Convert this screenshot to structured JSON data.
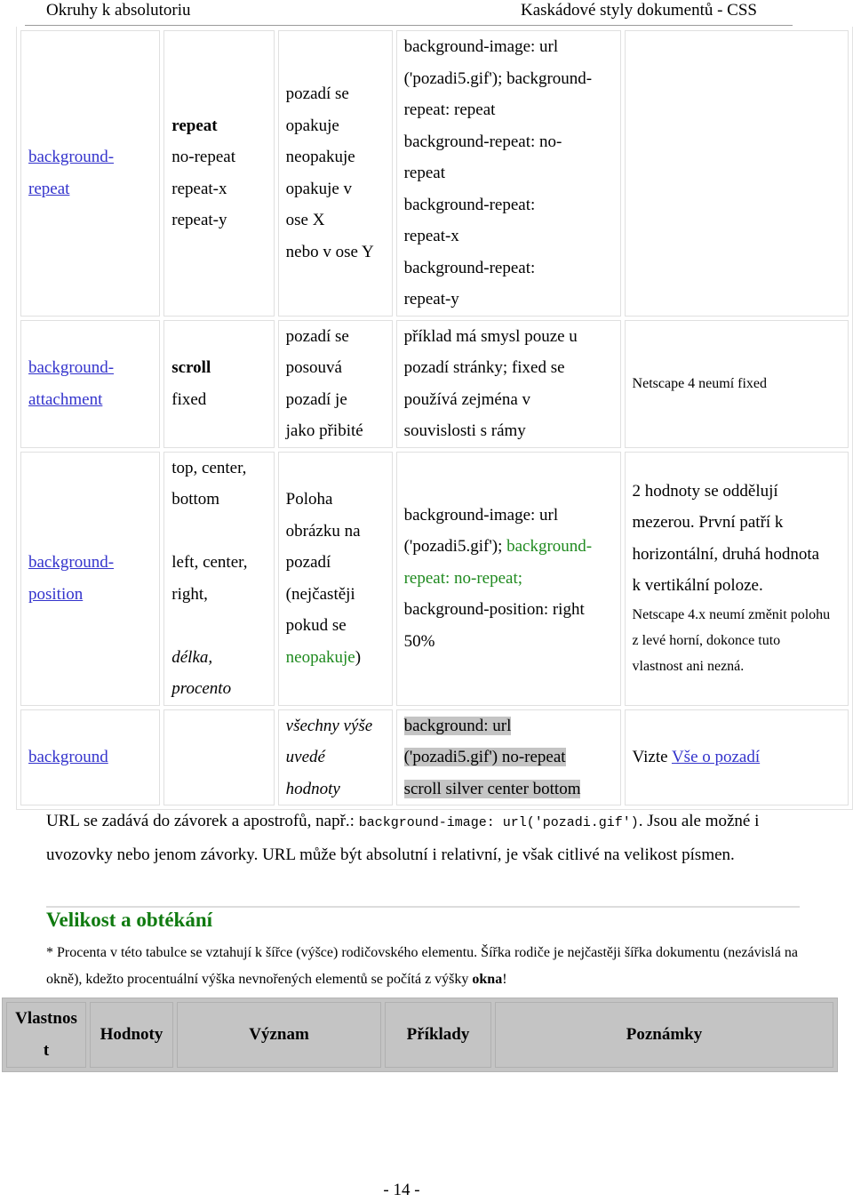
{
  "header": {
    "left": "Okruhy k absolutoriu",
    "right": "Kaskádové styly dokumentů - CSS"
  },
  "table": {
    "rows": [
      {
        "property": [
          "background-",
          "repeat"
        ],
        "values": [
          {
            "text": "repeat",
            "style": "bold"
          },
          {
            "text": "no-repeat"
          },
          {
            "text": "repeat-x"
          },
          {
            "text": "repeat-y"
          }
        ],
        "meaning": [
          "pozadí se",
          "opakuje",
          "neopakuje",
          "opakuje v",
          "ose X",
          "nebo v ose Y"
        ],
        "example": [
          "background-image: url",
          "('pozadi5.gif'); background-",
          "repeat: repeat",
          "background-repeat: no-",
          "repeat",
          "background-repeat:",
          "repeat-x",
          "background-repeat:",
          "repeat-y"
        ],
        "note": []
      },
      {
        "property": [
          "background-",
          "attachment"
        ],
        "values": [
          {
            "text": "scroll",
            "style": "bold"
          },
          {
            "text": "fixed"
          }
        ],
        "meaning": [
          "pozadí se",
          "posouvá",
          "pozadí je",
          "jako přibité"
        ],
        "example": [
          "příklad má smysl pouze u",
          "pozadí stránky; fixed se",
          "používá zejména v",
          "souvislosti s rámy"
        ],
        "note": [
          "Netscape 4 neumí fixed"
        ]
      },
      {
        "property": [
          "background-",
          "position"
        ],
        "values": [
          {
            "text": "top, center,"
          },
          {
            "text": "bottom"
          },
          {
            "text": ""
          },
          {
            "text": "left, center,"
          },
          {
            "text": "right,"
          },
          {
            "text": ""
          },
          {
            "text": "délka,",
            "style": "italic"
          },
          {
            "text": "procento",
            "style": "italic"
          }
        ],
        "meaning": [
          "Poloha",
          "obrázku na",
          "pozadí",
          "(nejčastěji",
          "pokud se"
        ],
        "meaning_last": {
          "green": "neopakuje",
          "tail": ")"
        },
        "example_parts": {
          "line1": "background-image: url",
          "line2_black": "('pozadi5.gif'); ",
          "line2_green": "background-",
          "line3_green": "repeat: no-repeat;",
          "line4": "background-position: right",
          "line5": "50%"
        },
        "note_main": [
          "2 hodnoty se oddělují",
          "mezerou. První patří k",
          "horizontální, druhá hodnota",
          "k vertikální poloze."
        ],
        "note_small": [
          "Netscape 4.x neumí změnit polohu",
          "z levé horní, dokonce tuto",
          "vlastnost ani nezná."
        ]
      },
      {
        "property": [
          "background"
        ],
        "values": [],
        "meaning": [
          "všechny výše",
          "uvedé",
          "hodnoty"
        ],
        "example": [
          "background: url",
          "('pozadi5.gif') no-repeat",
          "scroll silver center bottom"
        ],
        "note_prefix": "Vizte ",
        "note_link": "Vše o pozadí"
      }
    ]
  },
  "paragraph": {
    "part1": "URL se zadává do závorek a apostrofů, např.: ",
    "code": "background-image: url('pozadi.gif')",
    "part2": ". Jsou ale možné i uvozovky nebo jenom závorky. URL může být absolutní i relativní, je však citlivé na velikost písmen."
  },
  "section_title": "Velikost a obtékání",
  "note": {
    "text": "* Procenta v této tabulce se vztahují k šířce (výšce) rodičovského elementu. Šířka rodiče je nejčastěji  šířka dokumentu (nezávislá na okně), kdežto procentuální výška nevnořených elementů se počítá z výšky ",
    "bold": "okna",
    "end": "!"
  },
  "header_table": {
    "columns": [
      "Vlastnos t",
      "Hodnoty",
      "Význam",
      "Příklady",
      "Poznámky"
    ]
  },
  "page_number": "- 14 -",
  "colors": {
    "link": "#3333cc",
    "green": "#1f8a1f",
    "heading_green": "#0f7a0f",
    "highlight": "#c4c4c4"
  }
}
